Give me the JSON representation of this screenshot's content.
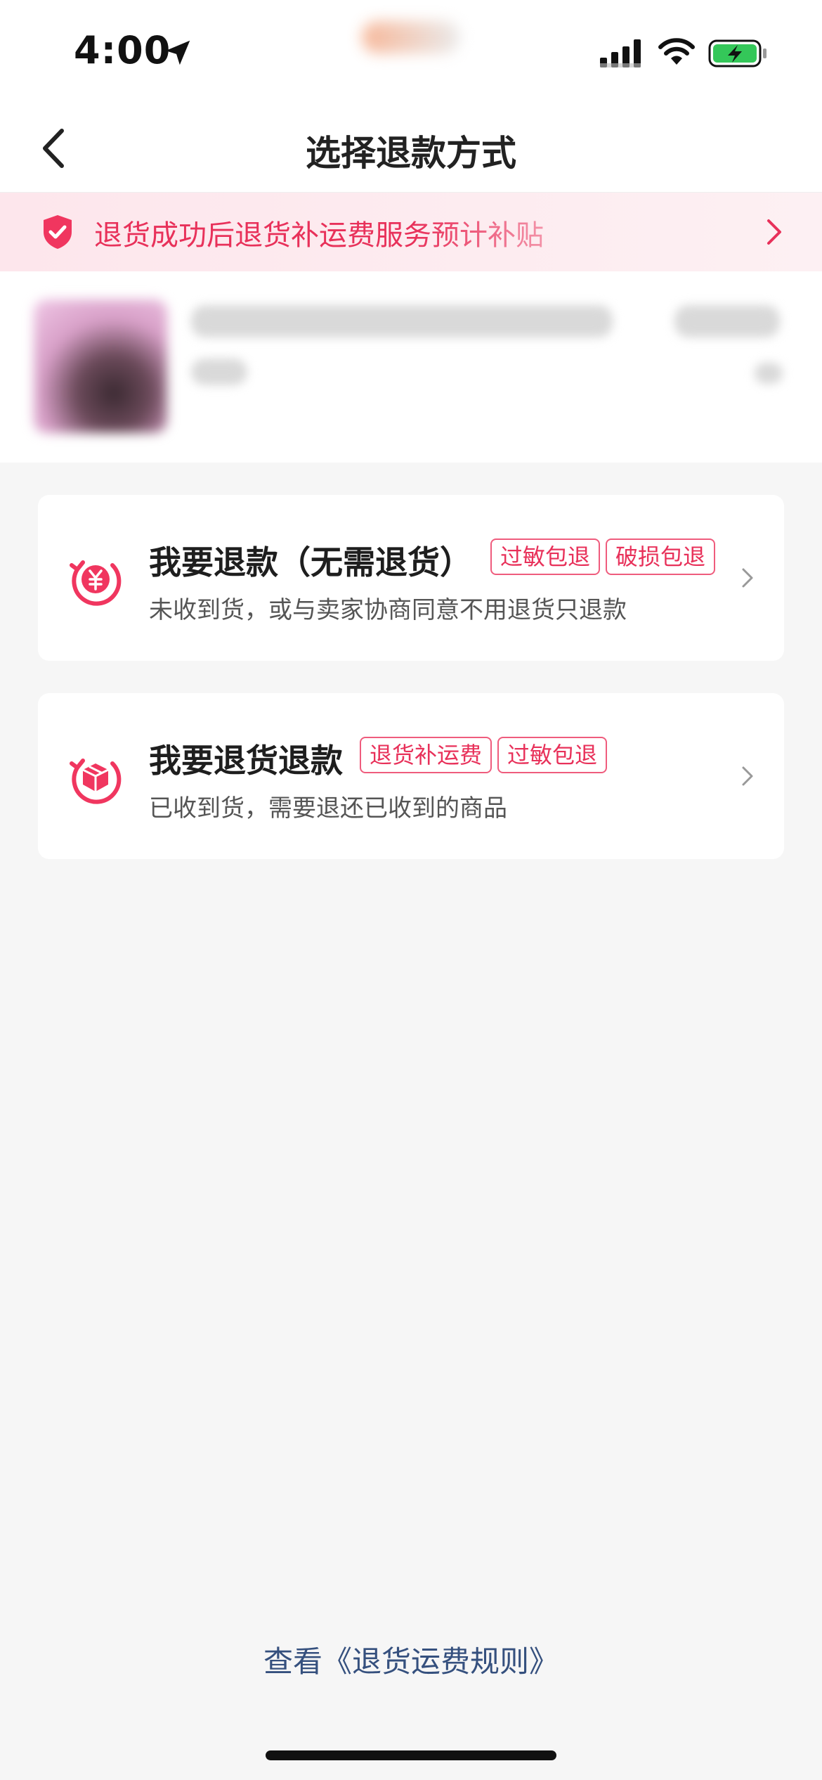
{
  "status_bar": {
    "time": "4:00",
    "icons": [
      "location-arrow-icon",
      "signal-icon",
      "wifi-icon",
      "battery-charging-icon"
    ],
    "battery_color": "#34c759"
  },
  "nav": {
    "title": "选择退款方式",
    "back_icon": "chevron-left-icon"
  },
  "banner": {
    "icon": "shield-check-icon",
    "text": "退货成功后退货补运费服务预计补贴",
    "accent": "#e8315a"
  },
  "options": [
    {
      "title": "我要退款（无需退货）",
      "tags": [
        "过敏包退",
        "破损包退"
      ],
      "description": "未收到货，或与卖家协商同意不用退货只退款",
      "icon": "refund-yuan-icon"
    },
    {
      "title": "我要退货退款",
      "tags": [
        "退货补运费",
        "过敏包退"
      ],
      "description": "已收到货，需要退还已收到的商品",
      "icon": "return-box-icon"
    }
  ],
  "footer": {
    "rules_link": "查看《退货运费规则》"
  },
  "colors": {
    "accent": "#e8315a",
    "link": "#35507e",
    "background": "#f6f6f6"
  }
}
